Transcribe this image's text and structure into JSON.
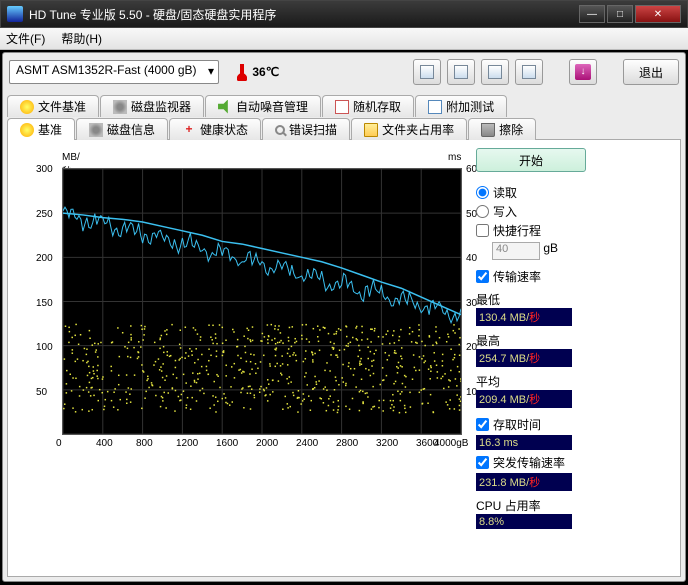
{
  "window": {
    "title": "HD Tune 专业版 5.50 - 硬盘/固态硬盘实用程序"
  },
  "menu": {
    "file": "文件(F)",
    "help": "帮助(H)"
  },
  "toolbar": {
    "device": "ASMT  ASM1352R-Fast (4000 gB)",
    "temp": "36℃",
    "exit": "退出"
  },
  "tabs_top": [
    {
      "label": "文件基准"
    },
    {
      "label": "磁盘监视器"
    },
    {
      "label": "自动噪音管理"
    },
    {
      "label": "随机存取"
    },
    {
      "label": "附加测试"
    }
  ],
  "tabs_bot": [
    {
      "label": "基准",
      "active": true
    },
    {
      "label": "磁盘信息"
    },
    {
      "label": "健康状态"
    },
    {
      "label": "错误扫描"
    },
    {
      "label": "文件夹占用率"
    },
    {
      "label": "擦除"
    }
  ],
  "chart": {
    "y_left_label": "MB/秒",
    "y_right_label": "ms",
    "y_left_ticks": [
      300,
      250,
      200,
      150,
      100,
      50
    ],
    "y_right_ticks": [
      60,
      50,
      40,
      30,
      20,
      10
    ],
    "x_ticks": [
      0,
      400,
      800,
      1200,
      1600,
      2000,
      2400,
      2800,
      3200,
      3600
    ],
    "x_end": "4000gB"
  },
  "chart_data": {
    "type": "line+scatter",
    "x_range": [
      0,
      4000
    ],
    "xlabel": "gB",
    "series": [
      {
        "name": "传输速率",
        "axis": "left",
        "ylabel": "MB/秒",
        "ylim": [
          0,
          300
        ],
        "color": "#3bc0f0",
        "type": "line",
        "x": [
          0,
          200,
          400,
          600,
          800,
          1000,
          1200,
          1400,
          1600,
          1800,
          2000,
          2200,
          2400,
          2600,
          2800,
          3000,
          3200,
          3400,
          3600,
          3800,
          4000
        ],
        "y": [
          250,
          248,
          245,
          243,
          240,
          235,
          230,
          225,
          218,
          215,
          210,
          205,
          200,
          195,
          188,
          180,
          172,
          165,
          155,
          145,
          135
        ]
      },
      {
        "name": "存取时间",
        "axis": "right",
        "ylabel": "ms",
        "ylim": [
          0,
          60
        ],
        "color": "#e6e640",
        "type": "scatter",
        "approx_cloud": {
          "y_min": 5,
          "y_max": 25,
          "mean": 16.3,
          "note": "dense random scatter across full x range"
        }
      }
    ]
  },
  "side": {
    "start": "开始",
    "read": "读取",
    "write": "写入",
    "short": "快捷行程",
    "short_val": "40",
    "short_unit": "gB",
    "xfer_chk": "传输速率",
    "min_lbl": "最低",
    "min_val": "130.4 MB/",
    "min_unit": "秒",
    "max_lbl": "最高",
    "max_val": "254.7 MB/",
    "max_unit": "秒",
    "avg_lbl": "平均",
    "avg_val": "209.4 MB/",
    "avg_unit": "秒",
    "access_chk": "存取时间",
    "access_val": "16.3 ms",
    "burst_chk": "突发传输速率",
    "burst_val": "231.8 MB/",
    "burst_unit": "秒",
    "cpu_lbl": "CPU 占用率",
    "cpu_val": "8.8%"
  }
}
